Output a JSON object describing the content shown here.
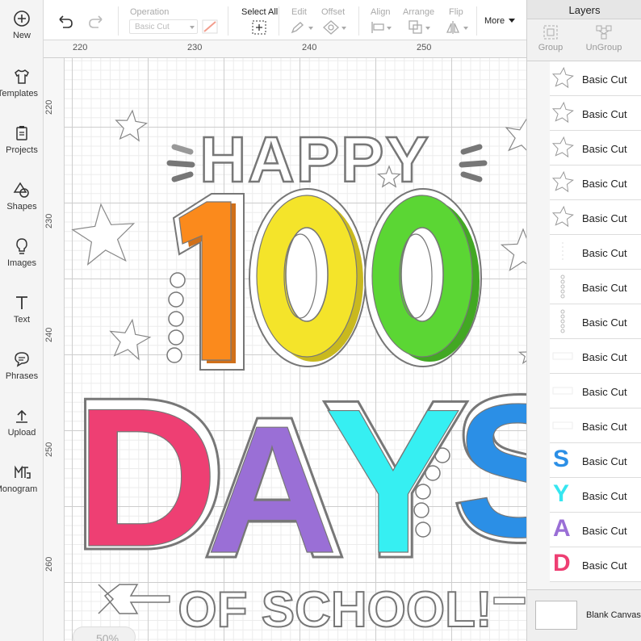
{
  "sidebar": {
    "items": [
      {
        "label": "New",
        "icon": "plus-circle-icon"
      },
      {
        "label": "Templates",
        "icon": "shirt-icon"
      },
      {
        "label": "Projects",
        "icon": "projects-icon"
      },
      {
        "label": "Shapes",
        "icon": "shapes-icon"
      },
      {
        "label": "Images",
        "icon": "lightbulb-icon"
      },
      {
        "label": "Text",
        "icon": "text-icon"
      },
      {
        "label": "Phrases",
        "icon": "speech-bubble-icon"
      },
      {
        "label": "Upload",
        "icon": "upload-icon"
      },
      {
        "label": "Monogram",
        "icon": "monogram-icon"
      }
    ]
  },
  "toolbar": {
    "operation_label": "Operation",
    "operation_value": "Basic Cut",
    "select_all_label": "Select All",
    "edit_label": "Edit",
    "offset_label": "Offset",
    "align_label": "Align",
    "arrange_label": "Arrange",
    "flip_label": "Flip",
    "more_label": "More"
  },
  "ruler": {
    "top_ticks": [
      "220",
      "230",
      "240",
      "250"
    ],
    "left_ticks": [
      "220",
      "230",
      "240",
      "250",
      "260"
    ]
  },
  "canvas": {
    "zoom": "50%",
    "design_text": {
      "happy": "HAPPY",
      "d": "D",
      "a": "A",
      "y": "Y",
      "s": "S",
      "of_school": "OF SCHOOL!"
    }
  },
  "layers_panel": {
    "title": "Layers",
    "group_label": "Group",
    "ungroup_label": "UnGroup",
    "layers": [
      {
        "name": "Basic Cut",
        "thumb": "star"
      },
      {
        "name": "Basic Cut",
        "thumb": "star"
      },
      {
        "name": "Basic Cut",
        "thumb": "star"
      },
      {
        "name": "Basic Cut",
        "thumb": "star"
      },
      {
        "name": "Basic Cut",
        "thumb": "star"
      },
      {
        "name": "Basic Cut",
        "thumb": "line"
      },
      {
        "name": "Basic Cut",
        "thumb": "dots"
      },
      {
        "name": "Basic Cut",
        "thumb": "dots"
      },
      {
        "name": "Basic Cut",
        "thumb": "faint"
      },
      {
        "name": "Basic Cut",
        "thumb": "faint"
      },
      {
        "name": "Basic Cut",
        "thumb": "faint"
      },
      {
        "name": "Basic Cut",
        "thumb": "S",
        "color": "#2b8fe6"
      },
      {
        "name": "Basic Cut",
        "thumb": "Y",
        "color": "#36e6f0"
      },
      {
        "name": "Basic Cut",
        "thumb": "A",
        "color": "#9a6fd6"
      },
      {
        "name": "Basic Cut",
        "thumb": "D",
        "color": "#ee3f73"
      }
    ],
    "blank_canvas_label": "Blank Canvas"
  },
  "colors": {
    "one": "#fb8a1c",
    "zero_first": "#f4e42a",
    "zero_second": "#5bd634",
    "d": "#ee3f73",
    "a": "#9a6fd6",
    "y": "#36eff2",
    "s": "#2b8fe6"
  }
}
